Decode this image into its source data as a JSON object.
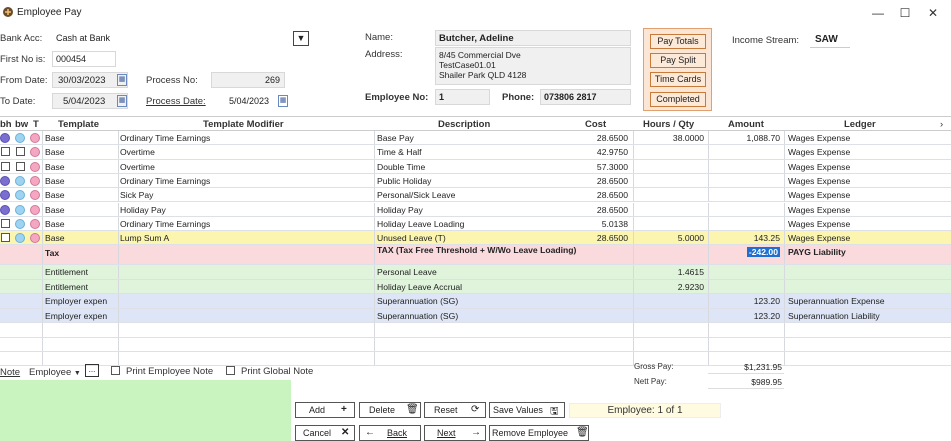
{
  "window": {
    "title": "Employee Pay",
    "minimize": "—",
    "maximize": "☐",
    "close": "✕"
  },
  "header": {
    "bank_acc_label": "Bank Acc:",
    "bank_acc_value": "Cash at Bank",
    "first_no_label": "First No is:",
    "first_no_value": "000454",
    "from_date_label": "From Date:",
    "from_date_value": "30/03/2023",
    "to_date_label": "To Date:",
    "to_date_value": "5/04/2023",
    "process_no_label": "Process No:",
    "process_no_value": "269",
    "process_date_label": "Process Date:",
    "process_date_value": "5/04/2023",
    "name_label": "Name:",
    "name_value": "Butcher, Adeline",
    "address_label": "Address:",
    "address_lines": [
      "8/45 Commercial Dve",
      "TestCase01.01",
      "Shailer Park QLD 4128"
    ],
    "employee_no_label": "Employee No:",
    "employee_no_value": "1",
    "phone_label": "Phone:",
    "phone_value": "073806 2817",
    "income_stream_label": "Income Stream:",
    "income_stream_value": "SAW"
  },
  "side_buttons": {
    "pay_totals": "Pay Totals",
    "pay_split": "Pay Split",
    "time_cards": "Time Cards",
    "completed": "Completed"
  },
  "columns": {
    "bh": "bh",
    "bw": "bw",
    "t": "T",
    "template": "Template",
    "template_modifier": "Template Modifier",
    "description": "Description",
    "cost": "Cost",
    "hours_qty": "Hours / Qty",
    "amount": "Amount",
    "ledger": "Ledger"
  },
  "rows": [
    {
      "template": "Base",
      "modifier": "Ordinary Time Earnings",
      "description": "Base Pay",
      "cost": "28.6500",
      "hours": "38.0000",
      "amount": "1,088.70",
      "ledger": "Wages Expense"
    },
    {
      "template": "Base",
      "modifier": "Overtime",
      "description": "Time & Half",
      "cost": "42.9750",
      "hours": "",
      "amount": "",
      "ledger": "Wages Expense"
    },
    {
      "template": "Base",
      "modifier": "Overtime",
      "description": "Double Time",
      "cost": "57.3000",
      "hours": "",
      "amount": "",
      "ledger": "Wages Expense"
    },
    {
      "template": "Base",
      "modifier": "Ordinary Time Earnings",
      "description": "Public Holiday",
      "cost": "28.6500",
      "hours": "",
      "amount": "",
      "ledger": "Wages Expense"
    },
    {
      "template": "Base",
      "modifier": "Sick Pay",
      "description": "Personal/Sick Leave",
      "cost": "28.6500",
      "hours": "",
      "amount": "",
      "ledger": "Wages Expense"
    },
    {
      "template": "Base",
      "modifier": "Holiday Pay",
      "description": "Holiday Pay",
      "cost": "28.6500",
      "hours": "",
      "amount": "",
      "ledger": "Wages Expense"
    },
    {
      "template": "Base",
      "modifier": "Ordinary Time Earnings",
      "description": "Holiday Leave Loading",
      "cost": "5.0138",
      "hours": "",
      "amount": "",
      "ledger": "Wages Expense"
    },
    {
      "template": "Base",
      "modifier": "Lump Sum A",
      "description": "Unused Leave (T)",
      "cost": "28.6500",
      "hours": "5.0000",
      "amount": "143.25",
      "ledger": "Wages Expense"
    },
    {
      "template": "Tax",
      "modifier": "",
      "description": "TAX (Tax Free Threshold  + W/Wo Leave Loading)",
      "cost": "",
      "hours": "",
      "amount": "-242.00",
      "ledger": "PAYG Liability"
    },
    {
      "template": "Entitlement",
      "modifier": "",
      "description": "Personal Leave",
      "cost": "",
      "hours": "1.4615",
      "amount": "",
      "ledger": ""
    },
    {
      "template": "Entitlement",
      "modifier": "",
      "description": "Holiday Leave Accrual",
      "cost": "",
      "hours": "2.9230",
      "amount": "",
      "ledger": ""
    },
    {
      "template": "Employer expen",
      "modifier": "",
      "description": "Superannuation (SG)",
      "cost": "",
      "hours": "",
      "amount": "123.20",
      "ledger": "Superannuation Expense"
    },
    {
      "template": "Employer expen",
      "modifier": "",
      "description": "Superannuation (SG)",
      "cost": "",
      "hours": "",
      "amount": "123.20",
      "ledger": "Superannuation Liability"
    }
  ],
  "footer": {
    "note_label": "Note",
    "note_type": "Employee",
    "ellipsis": "...",
    "print_employee_note": "Print Employee Note",
    "print_global_note": "Print Global Note",
    "gross_pay_label": "Gross Pay:",
    "gross_pay_value": "$1,231.95",
    "nett_pay_label": "Nett Pay:",
    "nett_pay_value": "$989.95",
    "employee_counter": "Employee: 1 of 1"
  },
  "actions": {
    "add": "Add",
    "delete": "Delete",
    "reset": "Reset",
    "save_values": "Save Values",
    "cancel": "Cancel",
    "back": "Back",
    "next": "Next",
    "remove_employee": "Remove Employee"
  },
  "colors": {
    "tax_row": "#fadadd",
    "entitlement_row": "#e0f4dc",
    "employer_row": "#dde5f6",
    "highlight_row": "#fbf5b0",
    "note_area": "#c9f4c0",
    "orange_panel": "#fbe5d4"
  }
}
